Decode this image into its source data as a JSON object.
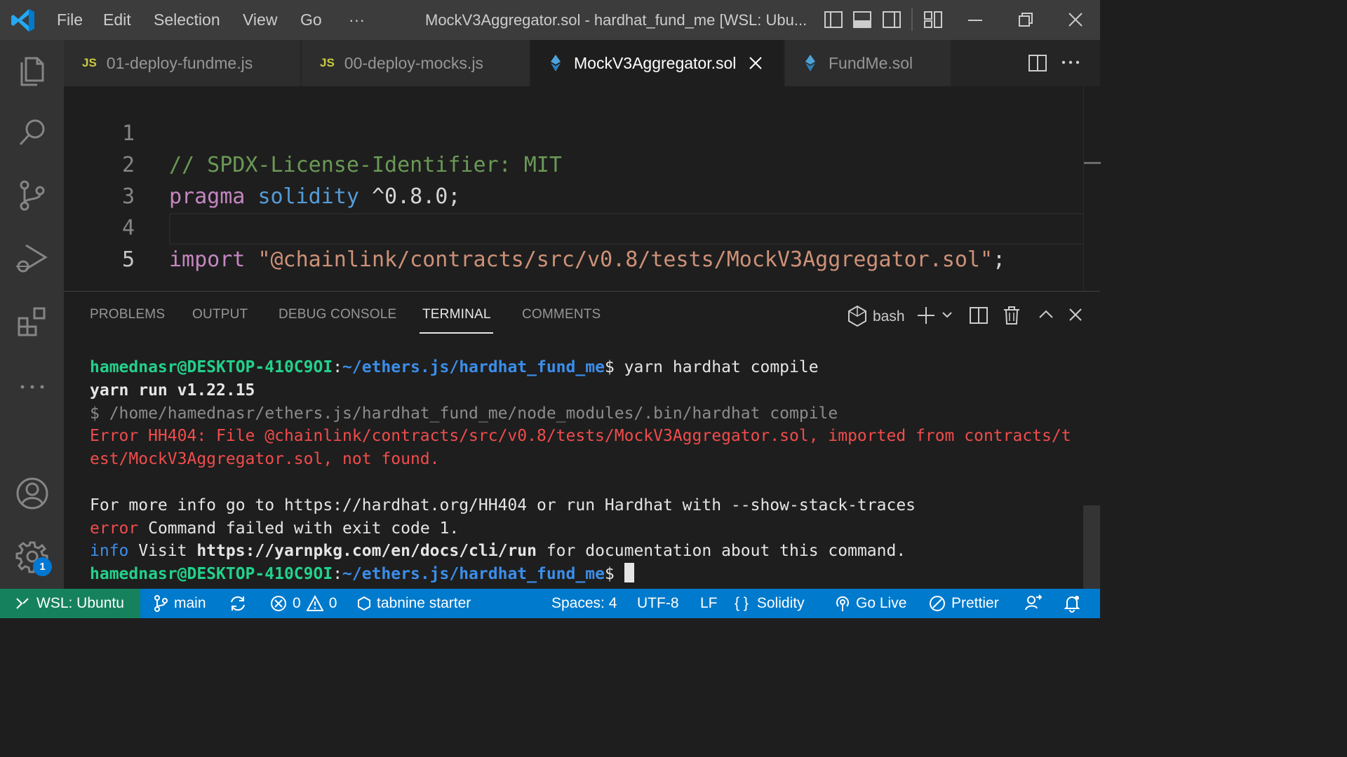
{
  "titlebar": {
    "menu": [
      "File",
      "Edit",
      "Selection",
      "View",
      "Go",
      "···"
    ],
    "window_title": "MockV3Aggregator.sol - hardhat_fund_me [WSL: Ubu..."
  },
  "tabs": [
    {
      "icon": "JS",
      "label": "01-deploy-fundme.js",
      "active": false
    },
    {
      "icon": "JS",
      "label": "00-deploy-mocks.js",
      "active": false
    },
    {
      "icon": "solidity-icon",
      "label": "MockV3Aggregator.sol",
      "active": true
    },
    {
      "icon": "solidity-icon",
      "label": "FundMe.sol",
      "active": false
    }
  ],
  "editor": {
    "lines": [
      {
        "n": "1",
        "comment": "// SPDX-License-Identifier: MIT"
      },
      {
        "n": "2",
        "kw": "pragma",
        "type": "solidity",
        "rest": " ^0.8.0;"
      },
      {
        "n": "3"
      },
      {
        "n": "4",
        "kw": "import",
        "str": "\"@chainlink/contracts/src/v0.8/tests/MockV3Aggregator.sol\"",
        "rest": ";"
      },
      {
        "n": "5"
      }
    ]
  },
  "panel": {
    "tabs": [
      "PROBLEMS",
      "OUTPUT",
      "DEBUG CONSOLE",
      "TERMINAL",
      "COMMENTS"
    ],
    "active_tab": "TERMINAL",
    "shell": "bash"
  },
  "terminal": {
    "prompt_user": "hamednasr@DESKTOP-410C9OI",
    "prompt_path": "~/ethers.js/hardhat_fund_me",
    "command": " yarn hardhat compile",
    "yarn_run": "yarn run v1.22.15",
    "run_line": "$ /home/hamednasr/ethers.js/hardhat_fund_me/node_modules/.bin/hardhat compile",
    "error_line_1": "Error HH404: File @chainlink/contracts/src/v0.8/tests/MockV3Aggregator.sol, imported from contracts/t",
    "error_line_2": "est/MockV3Aggregator.sol, not found.",
    "more_info": "For more info go to https://hardhat.org/HH404 or run Hardhat with --show-stack-traces",
    "error_word": "error",
    "error_msg": " Command failed with exit code 1.",
    "info_word": "info",
    "info_pre": " Visit ",
    "info_link": "https://yarnpkg.com/en/docs/cli/run",
    "info_post": " for documentation about this command."
  },
  "activity": {
    "settings_badge": "1"
  },
  "statusbar": {
    "remote": "WSL: Ubuntu",
    "branch": "main",
    "errors": "0",
    "warnings": "0",
    "tabnine": "tabnine starter",
    "spaces": "Spaces: 4",
    "encoding": "UTF-8",
    "eol": "LF",
    "language": "Solidity",
    "golive": "Go Live",
    "prettier": "Prettier"
  },
  "colors": {
    "accent": "#007acc",
    "remote": "#16825d",
    "prompt_green": "#23d18b",
    "prompt_blue": "#3b8eea",
    "error_red": "#f14c4c"
  }
}
